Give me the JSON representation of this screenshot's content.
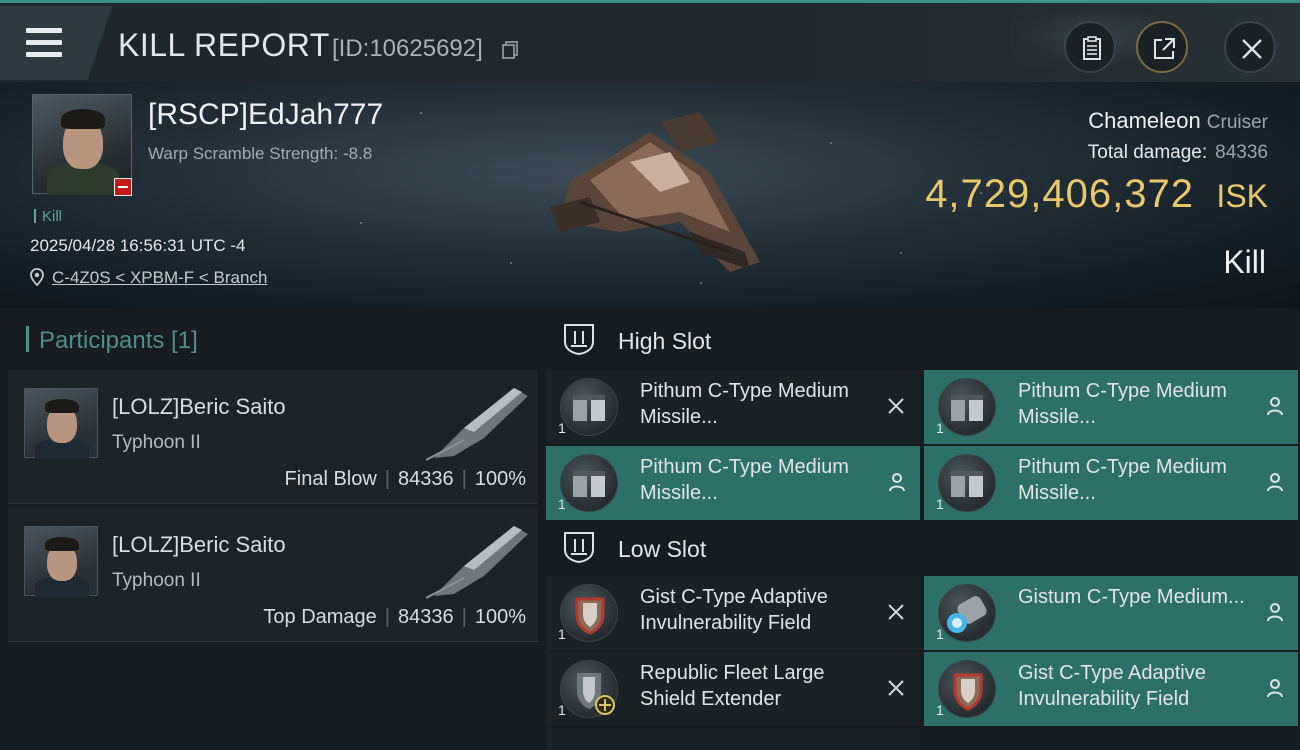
{
  "header": {
    "title": "KILL REPORT",
    "id_label": "[ID:10625692]"
  },
  "victim": {
    "name": "[RSCP]EdJah777",
    "warp_scramble": "Warp Scramble Strength: -8.8",
    "kill_tag": "Kill",
    "datetime": "2025/04/28 16:56:31 UTC -4",
    "location": "C-4Z0S < XPBM-F < Branch"
  },
  "ship": {
    "name": "Chameleon",
    "class": "Cruiser",
    "total_damage_label": "Total damage:",
    "total_damage": "84336",
    "isk_value": "4,729,406,372",
    "isk_unit": "ISK",
    "result": "Kill"
  },
  "participants": {
    "title": "Participants [1]",
    "rows": [
      {
        "name": "[LOLZ]Beric Saito",
        "ship": "Typhoon II",
        "role": "Final Blow",
        "damage": "84336",
        "percent": "100%"
      },
      {
        "name": "[LOLZ]Beric Saito",
        "ship": "Typhoon II",
        "role": "Top Damage",
        "damage": "84336",
        "percent": "100%"
      }
    ]
  },
  "high_slot": {
    "title": "High Slot",
    "modules": [
      {
        "name": "Pithum C-Type Medium Missile...",
        "qty": "1",
        "state": "destroyed",
        "icon": "launcher-icon"
      },
      {
        "name": "Pithum C-Type Medium Missile...",
        "qty": "1",
        "state": "dropped",
        "icon": "launcher-icon"
      },
      {
        "name": "Pithum C-Type Medium Missile...",
        "qty": "1",
        "state": "dropped",
        "icon": "launcher-icon"
      },
      {
        "name": "Pithum C-Type Medium Missile...",
        "qty": "1",
        "state": "dropped",
        "icon": "launcher-icon"
      }
    ]
  },
  "low_slot": {
    "title": "Low Slot",
    "modules": [
      {
        "name": "Gist C-Type Adaptive Invulnerability Field",
        "qty": "1",
        "state": "destroyed",
        "icon": "shield-hardener-icon"
      },
      {
        "name": "Gistum C-Type Medium...",
        "qty": "1",
        "state": "dropped",
        "icon": "shield-booster-icon"
      },
      {
        "name": "Republic Fleet Large Shield Extender",
        "qty": "1",
        "state": "destroyed",
        "icon": "shield-extender-icon"
      },
      {
        "name": "Gist C-Type Adaptive Invulnerability Field",
        "qty": "1",
        "state": "dropped",
        "icon": "shield-hardener-icon"
      }
    ]
  },
  "colors": {
    "accent_teal": "#2d6f69",
    "isk_gold": "#e9c86b",
    "security_red": "#c41a1a"
  }
}
